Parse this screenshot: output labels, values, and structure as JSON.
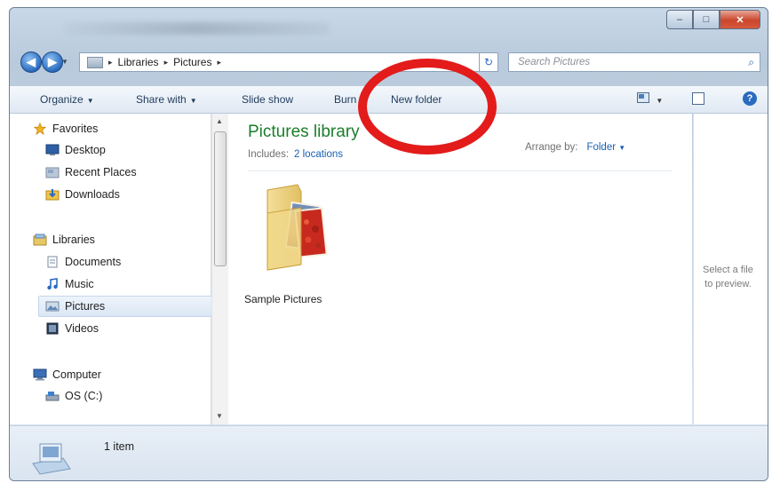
{
  "window": {
    "controls": {
      "minimize": "‒",
      "maximize": "□",
      "close": "✕"
    }
  },
  "address": {
    "crumbs": [
      "Libraries",
      "Pictures"
    ],
    "separator": "▸",
    "search_placeholder": "Search Pictures"
  },
  "toolbar": {
    "organize": "Organize",
    "share_with": "Share with",
    "slide_show": "Slide show",
    "burn": "Burn",
    "new_folder": "New folder",
    "view_icon": "view-options",
    "help": "?"
  },
  "sidebar": {
    "favorites": {
      "label": "Favorites",
      "items": [
        "Desktop",
        "Recent Places",
        "Downloads"
      ]
    },
    "libraries": {
      "label": "Libraries",
      "items": [
        "Documents",
        "Music",
        "Pictures",
        "Videos"
      ]
    },
    "computer": {
      "label": "Computer",
      "items": [
        "OS (C:)"
      ]
    },
    "selected": "Pictures"
  },
  "main": {
    "title": "Pictures library",
    "includes_label": "Includes:",
    "includes_link": "2 locations",
    "arrange_label": "Arrange by:",
    "arrange_value": "Folder",
    "items": [
      {
        "name": "Sample Pictures",
        "type": "folder"
      }
    ]
  },
  "preview": {
    "text_line1": "Select a file",
    "text_line2": "to preview."
  },
  "status": {
    "count": "1 item"
  },
  "colors": {
    "accent": "#2a6bc0",
    "library_title": "#1a7e2a",
    "annotation_ring": "#e31b1b"
  }
}
